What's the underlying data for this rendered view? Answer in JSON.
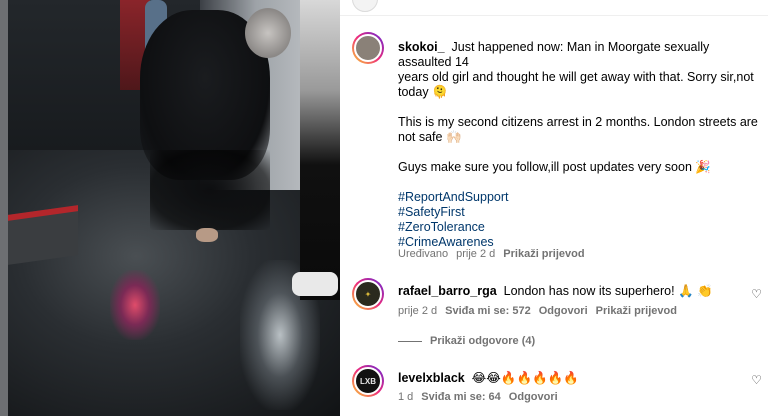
{
  "post": {
    "username": "skokoi_",
    "caption_lines": [
      "Just happened now: Man in Moorgate sexually assaulted 14",
      "years old girl and thought he will get away with that. Sorry sir,not",
      "today 🫠"
    ],
    "paragraph2_lines": [
      "This is my second citizens arrest in 2 months. London streets are",
      "not safe 🙌🏻"
    ],
    "paragraph3": "Guys make sure you follow,ill post updates very soon 🎉",
    "hashtags": [
      "#ReportAndSupport",
      "#SafetyFirst",
      "#ZeroTolerance",
      "#CrimeAwarenes"
    ],
    "meta": {
      "edited": "Uređivano",
      "time": "prije 2 d",
      "translate": "Prikaži prijevod"
    }
  },
  "comments": [
    {
      "username": "rafael_barro_rga",
      "text": "London has now its superhero! 🙏 👏",
      "meta": {
        "time": "prije 2 d",
        "likes": "Sviđa mi se: 572",
        "reply": "Odgovori",
        "translate": "Prikaži prijevod"
      },
      "view_replies": "Prikaži odgovore (4)",
      "avatar_color": "#d9b73a"
    },
    {
      "username": "levelxblack",
      "text": "😂😂🔥🔥🔥🔥🔥",
      "meta": {
        "time": "1 d",
        "likes": "Sviđa mi se: 64",
        "reply": "Odgovori"
      },
      "avatar_label": "LXB",
      "avatar_color": "#111111"
    }
  ],
  "icons": {
    "like": "heart-outline-icon"
  },
  "colors": {
    "hashtag": "#00376b",
    "muted": "#737373",
    "ring": "#ee2a7b"
  }
}
